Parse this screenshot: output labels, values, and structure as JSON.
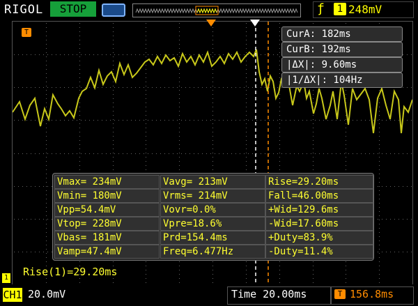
{
  "brand": "RIGOL",
  "run_state": "STOP",
  "trigger": {
    "channel": "1",
    "level": "248mV",
    "slope_icon": "rising-edge-icon"
  },
  "cursors": [
    {
      "label": "CurA: 182ms"
    },
    {
      "label": "CurB: 192ms"
    },
    {
      "label": "|ΔX|: 9.60ms"
    },
    {
      "label": "|1/ΔX|: 104Hz"
    }
  ],
  "measurements": [
    [
      "Vmax= 234mV",
      "Vavg= 213mV",
      "Rise=29.20ms"
    ],
    [
      "Vmin= 180mV",
      "Vrms= 214mV",
      "Fall=46.00ms"
    ],
    [
      "Vpp=54.4mV",
      "Vovr=0.0%",
      "+Wid=129.6ms"
    ],
    [
      "Vtop= 228mV",
      "Vpre=18.6%",
      "-Wid=17.60ms"
    ],
    [
      "Vbas= 181mV",
      "Prd=154.4ms",
      "+Duty=83.9%"
    ],
    [
      "Vamp=47.4mV",
      "Freq=6.477Hz",
      "-Duty=11.4%"
    ]
  ],
  "rise_readout": "Rise(1)=29.20ms",
  "channel": {
    "label": "CH1",
    "scale": "20.0mV"
  },
  "timebase": "Time 20.00ms",
  "trigger_offset": "156.8ms",
  "trigger_marker": "T",
  "channel_marker": "1",
  "colors": {
    "trace": "#c8c81a",
    "cursor_a": "#ffffff",
    "cursor_b": "#ff8c00",
    "accent": "#ffff00"
  }
}
